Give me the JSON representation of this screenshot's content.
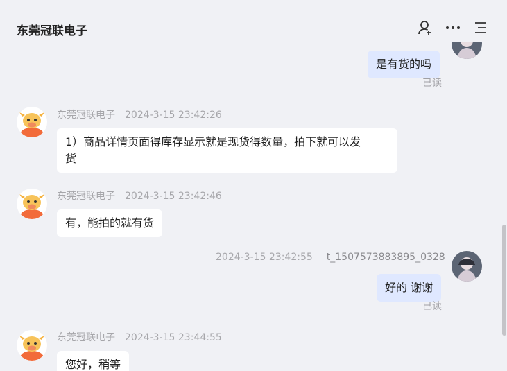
{
  "header": {
    "title": "东莞冠联电子",
    "icons": [
      "user-add-icon",
      "more-icon",
      "menu-icon"
    ]
  },
  "messages": [
    {
      "side": "me",
      "text": "是有货的吗",
      "read": "已读"
    },
    {
      "side": "them",
      "name": "东莞冠联电子",
      "time": "2024-3-15 23:42:26",
      "text_line1": "1）商品详情页面得库存显示就是现货得数量，拍下就可以发",
      "text_line2": "货"
    },
    {
      "side": "them",
      "name": "东莞冠联电子",
      "time": "2024-3-15 23:42:46",
      "text": "有，能拍的就有货"
    },
    {
      "side": "me",
      "name": "t_1507573883895_0328",
      "time": "2024-3-15 23:42:55",
      "text": "好的 谢谢",
      "read": "已读"
    },
    {
      "side": "them",
      "name": "东莞冠联电子",
      "time": "2024-3-15 23:44:55",
      "text": "您好，稍等"
    }
  ],
  "colors": {
    "my_bubble": "#dfe8ff",
    "their_bubble": "#ffffff",
    "background": "#f0f1f5"
  }
}
